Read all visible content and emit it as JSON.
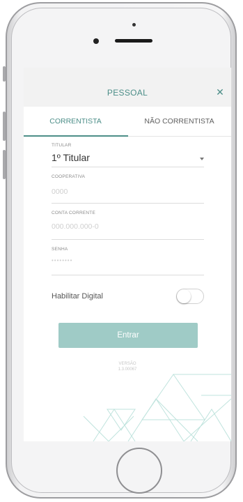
{
  "header": {
    "title": "PESSOAL",
    "close_icon": "close-icon"
  },
  "tabs": [
    {
      "label": "CORRENTISTA",
      "active": true
    },
    {
      "label": "NÃO CORRENTISTA",
      "active": false
    }
  ],
  "form": {
    "titular": {
      "label": "TITULAR",
      "value": "1º Titular"
    },
    "cooperativa": {
      "label": "COOPERATIVA",
      "placeholder": "0000"
    },
    "conta": {
      "label": "CONTA CORRENTE",
      "placeholder": "000.000.000-0"
    },
    "senha": {
      "label": "SENHA",
      "placeholder": "••••••••"
    },
    "digital": {
      "label": "Habilitar Digital",
      "enabled": false
    }
  },
  "enter_button": {
    "label": "Entrar"
  },
  "version": {
    "label": "VERSÃO",
    "number": "1.3.00067"
  },
  "colors": {
    "accent": "#4c8e88",
    "button": "#9fcbc6",
    "header_bg": "#f2f2f2"
  }
}
